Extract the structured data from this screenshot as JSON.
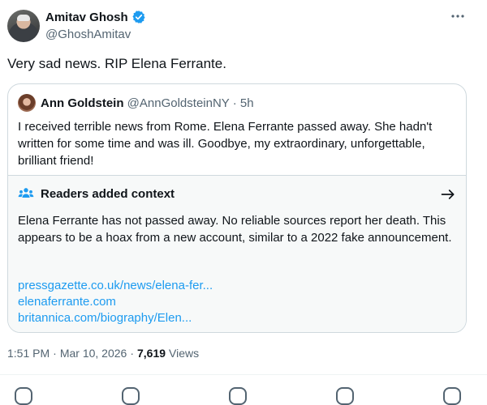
{
  "author": {
    "name": "Amitav Ghosh",
    "handle": "@GhoshAmitav"
  },
  "tweet": {
    "text": "Very sad news. RIP Elena Ferrante."
  },
  "quoted": {
    "name": "Ann Goldstein",
    "handle": "@AnnGoldsteinNY",
    "separator": " · ",
    "time": "5h",
    "text": "I received terrible news from Rome. Elena Ferrante passed away. She hadn't written for some time and was ill. Goodbye, my extraordinary, unforgettable, brilliant friend!"
  },
  "context": {
    "title": "Readers added context",
    "text": "Elena Ferrante has not passed away. No reliable sources report her death. This appears to be a hoax from a new account, similar to a 2022 fake announcement.",
    "links": [
      "pressgazette.co.uk/news/elena-fer...",
      "elenaferrante.com",
      "britannica.com/biography/Elen..."
    ]
  },
  "meta": {
    "time": "1:51 PM",
    "sep1": "·",
    "date": "Mar 10, 2026",
    "sep2": "·",
    "views_count": "7,619",
    "views_label": "Views"
  },
  "colors": {
    "accent": "#1d9bf0",
    "text_primary": "#0f1419",
    "text_secondary": "#536471",
    "border": "#cfd9de",
    "context_bg": "#f7f9f9"
  },
  "icons": {
    "verified": "verified-badge-icon",
    "more": "more-options-icon",
    "readers": "readers-icon",
    "arrow": "arrow-right-icon"
  }
}
